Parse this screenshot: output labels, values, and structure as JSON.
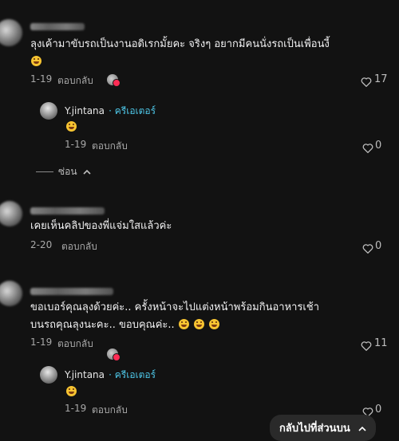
{
  "comments": [
    {
      "text": "ลุงเค้ามาขับรถเป็นงานอดิเรกมั้ยคะ จริงๆ อยากมีคนนั่งรถเป็นเพื่อนงี้",
      "date": "1-19",
      "reply_label": "ตอบกลับ",
      "likes": "17",
      "reply": {
        "username": "Y.jintana",
        "role": "ครีเอเตอร์",
        "date": "1-19",
        "reply_label": "ตอบกลับ",
        "likes": "0"
      },
      "collapse_label": "ซ่อน"
    },
    {
      "text": "เคยเห็นคลิปของพี่แจ่มใสแล้วค่ะ",
      "date": "2-20",
      "reply_label": "ตอบกลับ",
      "likes": "0"
    },
    {
      "text_line1": "ขอเบอร์คุณลุงด้วยค่ะ.. ครั้งหน้าจะไปแต่งหน้าพร้อมกินอาหารเช้า",
      "text_line2": "บนรถคุณลุงนะคะ.. ขอบคุณค่ะ..",
      "date": "1-19",
      "reply_label": "ตอบกลับ",
      "likes": "11",
      "reply": {
        "username": "Y.jintana",
        "role": "ครีเอเตอร์",
        "date": "1-19",
        "reply_label": "ตอบกลับ",
        "likes": "0"
      }
    }
  ],
  "back_to_top_label": "กลับไปที่ส่วนบน",
  "icons": {
    "heart": "heart-outline-icon",
    "chevron_up": "chevron-up-icon",
    "emoji": "grinning-emoji-icon"
  },
  "colors": {
    "background": "#121212",
    "creator_label": "#4ec7e8",
    "badge": "#fe2c55"
  }
}
